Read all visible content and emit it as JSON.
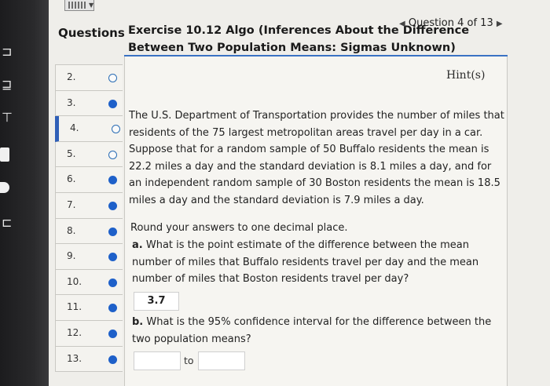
{
  "sidebar": {
    "title": "Questions",
    "items": [
      {
        "label": "2.",
        "status": "open"
      },
      {
        "label": "3.",
        "status": "done"
      },
      {
        "label": "4.",
        "status": "open"
      },
      {
        "label": "5.",
        "status": "open"
      },
      {
        "label": "6.",
        "status": "done"
      },
      {
        "label": "7.",
        "status": "done"
      },
      {
        "label": "8.",
        "status": "done"
      },
      {
        "label": "9.",
        "status": "done"
      },
      {
        "label": "10.",
        "status": "done"
      },
      {
        "label": "11.",
        "status": "done"
      },
      {
        "label": "12.",
        "status": "done"
      },
      {
        "label": "13.",
        "status": "done"
      }
    ],
    "active_label": "4."
  },
  "header": {
    "title": "Exercise 10.12 Algo (Inferences About the Difference Between Two Population Means: Sigmas Unknown)",
    "nav_prev_icon": "triangle-left-icon",
    "nav_text": "Question 4 of 13",
    "nav_next_icon": "triangle-right-icon"
  },
  "hint": "Hint(s)",
  "problem": {
    "text": "The U.S. Department of Transportation provides the number of miles that residents of the 75 largest metropolitan areas travel per day in a car. Suppose that for a random sample of 50 Buffalo residents the mean is 22.2 miles a day and the standard deviation is 8.1 miles a day, and for an independent random sample of 30 Boston residents the mean is 18.5 miles a day and the standard deviation is 7.9 miles a day.",
    "round_note": "Round your answers to one decimal place."
  },
  "part_a": {
    "label": "a.",
    "question": "What is the point estimate of the difference between the mean number of miles that Buffalo residents travel per day and the mean number of miles that Boston residents travel per day?",
    "answer": "3.7"
  },
  "part_b": {
    "label": "b.",
    "question": "What is the 95% confidence interval for the difference between the two population means?",
    "lower": "",
    "upper": "",
    "to_label": "to"
  },
  "colors": {
    "accent": "#2f5fb7",
    "status_done": "#1e60c9",
    "status_open": "#2a6db5"
  }
}
